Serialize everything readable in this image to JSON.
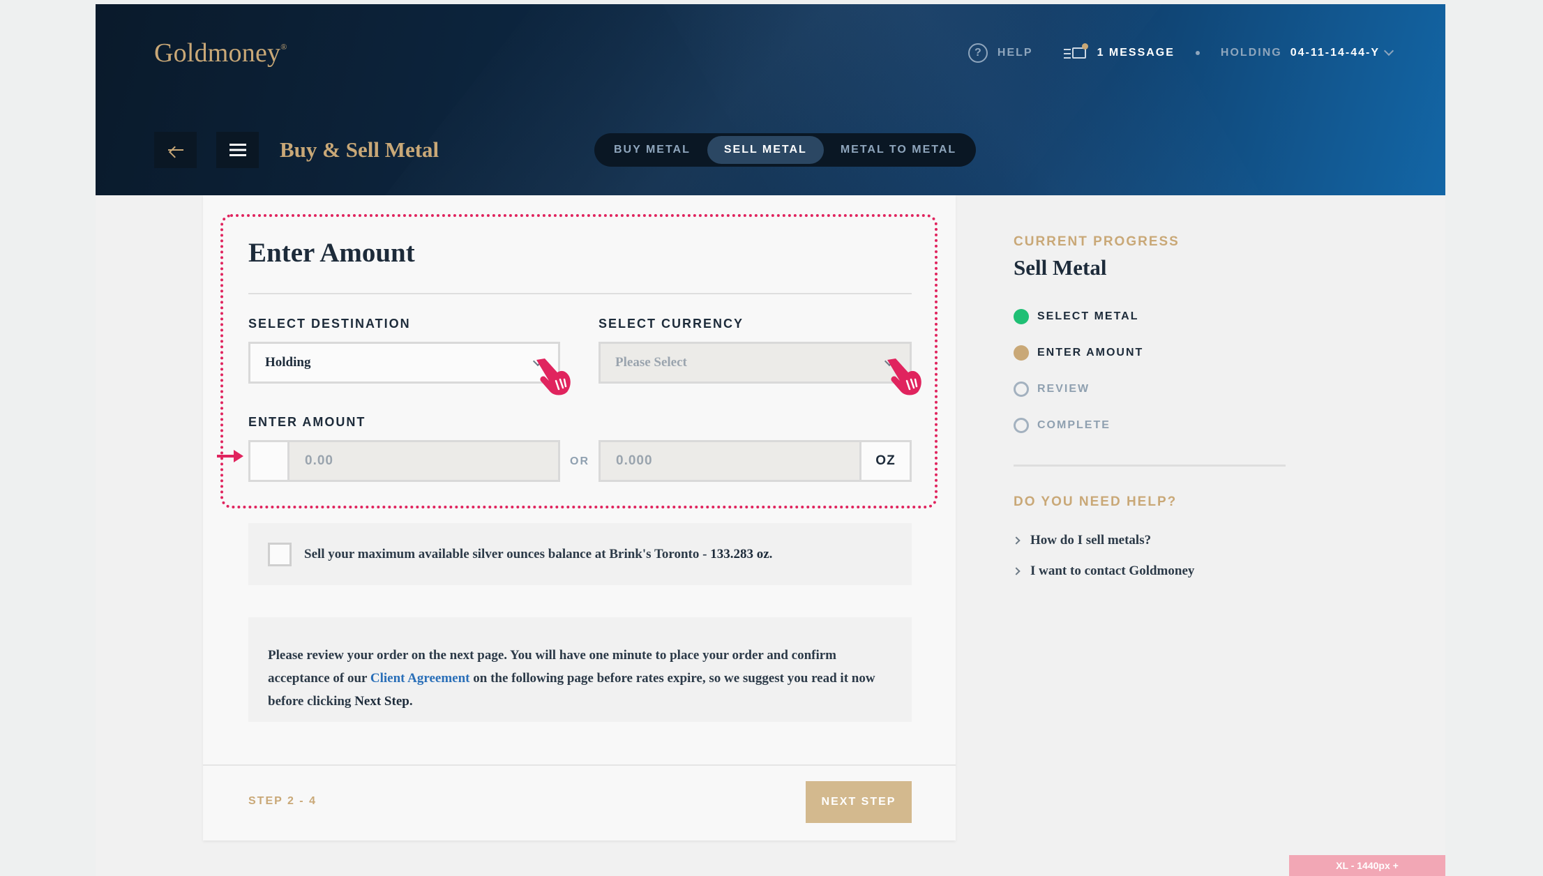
{
  "brand": {
    "logo": "Goldmoney",
    "logo_mark": "®",
    "accent": "#c9a877"
  },
  "topnav": {
    "help_icon": "?",
    "help_label": "HELP",
    "messages_label": "1 MESSAGE",
    "holding_label": "HOLDING",
    "holding_value": "04-11-14-44-Y"
  },
  "subbar": {
    "title": "Buy & Sell Metal"
  },
  "tabs": [
    {
      "label": "BUY METAL",
      "active": false
    },
    {
      "label": "SELL METAL",
      "active": true
    },
    {
      "label": "METAL TO METAL",
      "active": false
    }
  ],
  "form": {
    "title": "Enter Amount",
    "destination": {
      "label": "SELECT DESTINATION",
      "value": "Holding"
    },
    "currency": {
      "label": "SELECT CURRENCY",
      "placeholder": "Please Select"
    },
    "amount": {
      "label": "ENTER AMOUNT",
      "currency_placeholder": "0.00",
      "or": "OR",
      "oz_placeholder": "0.000",
      "unit": "OZ"
    },
    "max_option": {
      "text": "Sell your maximum available silver ounces balance at Brink's Toronto - ",
      "amount": "133.283 oz",
      "end": "."
    },
    "note": {
      "part1": "Please review your order on the next page. You will have one minute to place your order and confirm acceptance of our ",
      "link": "Client Agreement",
      "part2": " on the following page before rates expire, so we suggest you read it now before clicking ",
      "strong": "Next Step",
      "end": "."
    },
    "step": "STEP 2 - 4",
    "next_button": "NEXT STEP"
  },
  "progress": {
    "eyebrow": "CURRENT PROGRESS",
    "title": "Sell Metal",
    "steps": [
      {
        "label": "SELECT METAL",
        "state": "done"
      },
      {
        "label": "ENTER AMOUNT",
        "state": "current"
      },
      {
        "label": "REVIEW",
        "state": "todo"
      },
      {
        "label": "COMPLETE",
        "state": "todo"
      }
    ],
    "status_colors": {
      "done": "#1fbf74",
      "current": "#c9a877",
      "todo": "#a3b1bf"
    }
  },
  "help": {
    "title": "DO YOU NEED HELP?",
    "links": [
      "How do I sell metals?",
      "I want to contact Goldmoney"
    ]
  },
  "breakpoint_badge": "XL - 1440px +",
  "annotation_color": "#e0245e"
}
